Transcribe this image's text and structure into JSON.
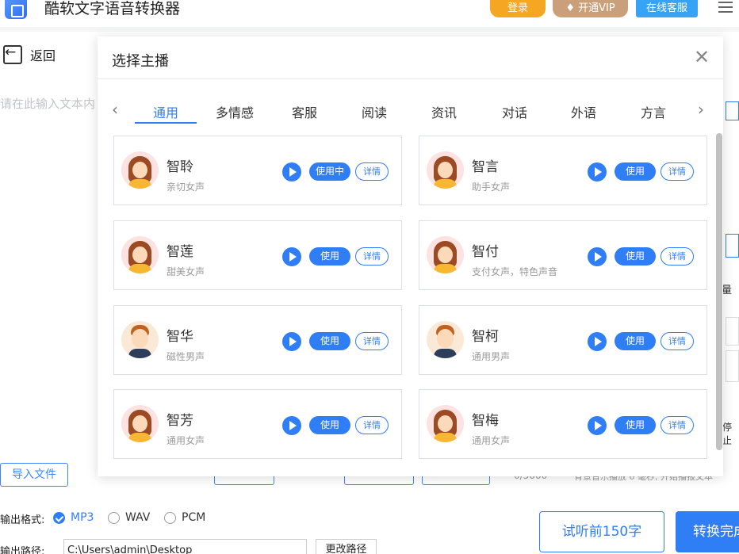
{
  "app": {
    "title": "酷软文字语音转换器",
    "login": "登录",
    "vip": "开通VIP",
    "service": "在线客服"
  },
  "editor": {
    "back": "返回",
    "placeholder": "请在此输入文本内",
    "import": "导入文件",
    "ghost_right_text": "背景音乐播放 0 毫秒, 开始播报文本",
    "ghost_count": "0/5000"
  },
  "bottom": {
    "format_label": "输出格式:",
    "formats": [
      "MP3",
      "WAV",
      "PCM"
    ],
    "selected_format": "MP3",
    "path_label": "输出路径:",
    "path_value": "C:\\Users\\admin\\Desktop",
    "change_path": "更改路径",
    "preview": "试听前150字",
    "convert": "转换完成"
  },
  "side": {
    "label_1": "量",
    "label_2": "停止"
  },
  "modal": {
    "title": "选择主播",
    "prev_arrow": "‹",
    "next_arrow": "›",
    "tabs": [
      "通用",
      "多情感",
      "客服",
      "阅读",
      "资讯",
      "对话",
      "外语",
      "方言"
    ],
    "active_tab": "通用",
    "voices": [
      {
        "name": "智聆",
        "desc": "亲切女声",
        "use": "使用中",
        "detail": "详情",
        "gender": "female"
      },
      {
        "name": "智言",
        "desc": "助手女声",
        "use": "使用",
        "detail": "详情",
        "gender": "female"
      },
      {
        "name": "智莲",
        "desc": "甜美女声",
        "use": "使用",
        "detail": "详情",
        "gender": "female"
      },
      {
        "name": "智付",
        "desc": "支付女声，特色声音",
        "use": "使用",
        "detail": "详情",
        "gender": "female"
      },
      {
        "name": "智华",
        "desc": "磁性男声",
        "use": "使用",
        "detail": "详情",
        "gender": "male"
      },
      {
        "name": "智柯",
        "desc": "通用男声",
        "use": "使用",
        "detail": "详情",
        "gender": "male"
      },
      {
        "name": "智芳",
        "desc": "通用女声",
        "use": "使用",
        "detail": "详情",
        "gender": "female"
      },
      {
        "name": "智梅",
        "desc": "通用女声",
        "use": "使用",
        "detail": "详情",
        "gender": "female"
      }
    ]
  },
  "colors": {
    "accent": "#2f7ef6",
    "login": "#f5a623",
    "vip": "#c9a07a",
    "service": "#36a3f7"
  }
}
